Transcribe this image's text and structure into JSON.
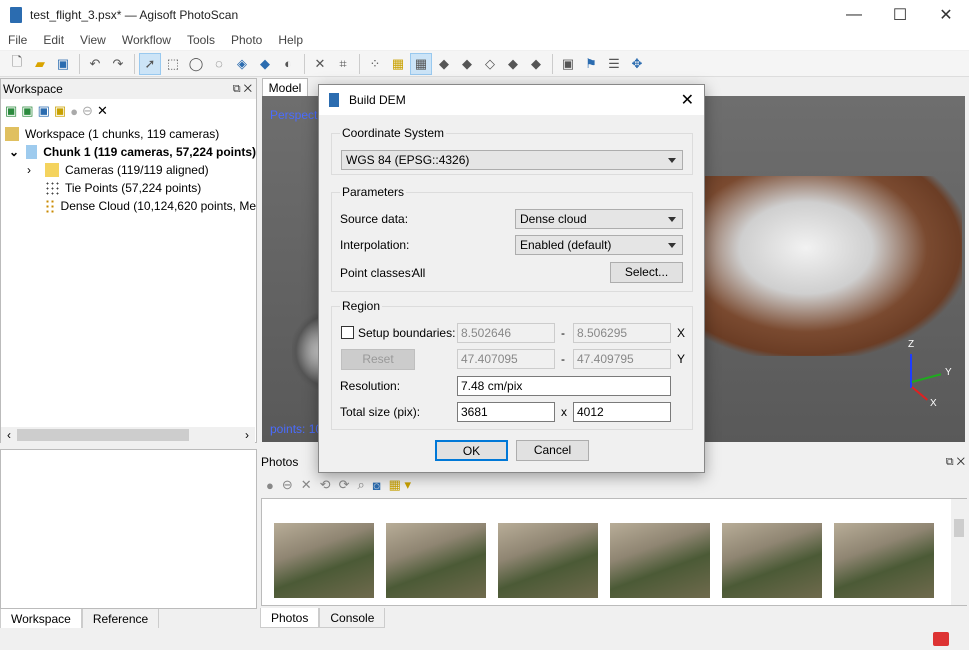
{
  "window": {
    "title": "test_flight_3.psx* — Agisoft PhotoScan",
    "minimize": "—",
    "maximize": "☐",
    "close": "✕"
  },
  "menu": [
    "File",
    "Edit",
    "View",
    "Workflow",
    "Tools",
    "Photo",
    "Help"
  ],
  "workspace": {
    "title": "Workspace",
    "items": [
      {
        "label": "Workspace (1 chunks, 119 cameras)"
      },
      {
        "label": "Chunk 1 (119 cameras, 57,224 points)"
      },
      {
        "label": "Cameras (119/119 aligned)"
      },
      {
        "label": "Tie Points (57,224 points)"
      },
      {
        "label": "Dense Cloud (10,124,620 points, Me"
      }
    ],
    "tabs": [
      "Workspace",
      "Reference"
    ]
  },
  "model": {
    "tab": "Model",
    "perspective": "Perspective",
    "points": "points: 10",
    "axes": {
      "z": "Z",
      "y": "Y",
      "x": "X"
    }
  },
  "photos": {
    "title": "Photos",
    "tabs": [
      "Photos",
      "Console"
    ]
  },
  "dialog": {
    "title": "Build DEM",
    "coordinate_system": {
      "label": "Coordinate System",
      "value": "WGS 84 (EPSG::4326)"
    },
    "parameters": {
      "label": "Parameters",
      "source_label": "Source data:",
      "source_value": "Dense cloud",
      "interp_label": "Interpolation:",
      "interp_value": "Enabled (default)",
      "classes_label": "Point classes:",
      "classes_value": "All",
      "select_btn": "Select..."
    },
    "region": {
      "label": "Region",
      "setup_label": "Setup boundaries:",
      "x_min": "8.502646",
      "x_max": "8.506295",
      "x_axis": "X",
      "reset_btn": "Reset",
      "y_min": "47.407095",
      "y_max": "47.409795",
      "y_axis": "Y",
      "dash": "-",
      "resolution_label": "Resolution:",
      "resolution_value": "7.48 cm/pix",
      "size_label": "Total size (pix):",
      "size_w": "3681",
      "size_x": "x",
      "size_h": "4012"
    },
    "ok": "OK",
    "cancel": "Cancel"
  }
}
